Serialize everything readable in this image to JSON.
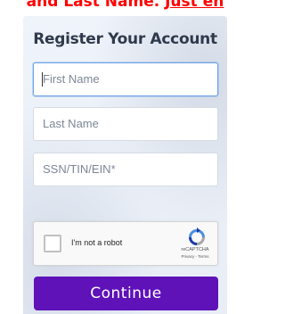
{
  "banner": {
    "text_before": "and Last Name. ",
    "text_underlined": "Just en"
  },
  "form": {
    "title": "Register Your Account",
    "first_name_placeholder": "First Name",
    "last_name_placeholder": "Last Name",
    "ssn_placeholder": "SSN/TIN/EIN*",
    "continue_label": "Continue"
  },
  "captcha": {
    "label": "I'm not a robot",
    "brand": "reCAPTCHA",
    "links": "Privacy - Terms",
    "logo_icon": "recaptcha-icon"
  },
  "colors": {
    "button": "#5e12b8",
    "banner": "#ff0000",
    "focus": "#6fa3e6"
  }
}
